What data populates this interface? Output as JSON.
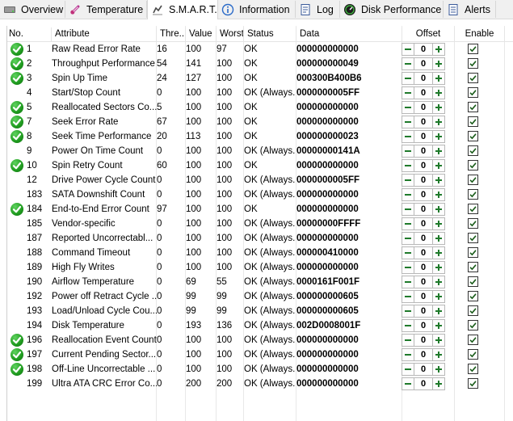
{
  "tabs": [
    {
      "label": "Overview",
      "icon": "drive-overview-icon"
    },
    {
      "label": "Temperature",
      "icon": "thermometer-icon"
    },
    {
      "label": "S.M.A.R.T.",
      "icon": "smart-icon"
    },
    {
      "label": "Information",
      "icon": "information-icon"
    },
    {
      "label": "Log",
      "icon": "log-icon"
    },
    {
      "label": "Disk Performance",
      "icon": "gauge-icon"
    },
    {
      "label": "Alerts",
      "icon": "alerts-icon"
    }
  ],
  "active_tab": "S.M.A.R.T.",
  "columns": {
    "no": "No.",
    "attribute": "Attribute",
    "threshold": "Thre...",
    "value": "Value",
    "worst": "Worst",
    "status": "Status",
    "data": "Data",
    "offset": "Offset",
    "enable": "Enable"
  },
  "colors": {
    "ok_green": "#1e9a1e",
    "stepper_green": "#1f7a2b"
  },
  "rows": [
    {
      "no": "1",
      "icon": true,
      "attribute": "Raw Read Error Rate",
      "threshold": "16",
      "value": "100",
      "worst": "97",
      "status": "OK",
      "data": "000000000000",
      "offset": "0",
      "enabled": true
    },
    {
      "no": "2",
      "icon": true,
      "attribute": "Throughput Performance",
      "threshold": "54",
      "value": "141",
      "worst": "100",
      "status": "OK",
      "data": "000000000049",
      "offset": "0",
      "enabled": true
    },
    {
      "no": "3",
      "icon": true,
      "attribute": "Spin Up Time",
      "threshold": "24",
      "value": "127",
      "worst": "100",
      "status": "OK",
      "data": "000300B400B6",
      "offset": "0",
      "enabled": true
    },
    {
      "no": "4",
      "icon": false,
      "attribute": "Start/Stop Count",
      "threshold": "0",
      "value": "100",
      "worst": "100",
      "status": "OK (Always...",
      "data": "0000000005FF",
      "offset": "0",
      "enabled": true
    },
    {
      "no": "5",
      "icon": true,
      "attribute": "Reallocated Sectors Co...",
      "threshold": "5",
      "value": "100",
      "worst": "100",
      "status": "OK",
      "data": "000000000000",
      "offset": "0",
      "enabled": true
    },
    {
      "no": "7",
      "icon": true,
      "attribute": "Seek Error Rate",
      "threshold": "67",
      "value": "100",
      "worst": "100",
      "status": "OK",
      "data": "000000000000",
      "offset": "0",
      "enabled": true
    },
    {
      "no": "8",
      "icon": true,
      "attribute": "Seek Time Performance",
      "threshold": "20",
      "value": "113",
      "worst": "100",
      "status": "OK",
      "data": "000000000023",
      "offset": "0",
      "enabled": true
    },
    {
      "no": "9",
      "icon": false,
      "attribute": "Power On Time Count",
      "threshold": "0",
      "value": "100",
      "worst": "100",
      "status": "OK (Always...",
      "data": "00000000141A",
      "offset": "0",
      "enabled": true
    },
    {
      "no": "10",
      "icon": true,
      "attribute": "Spin Retry Count",
      "threshold": "60",
      "value": "100",
      "worst": "100",
      "status": "OK",
      "data": "000000000000",
      "offset": "0",
      "enabled": true
    },
    {
      "no": "12",
      "icon": false,
      "attribute": "Drive Power Cycle Count",
      "threshold": "0",
      "value": "100",
      "worst": "100",
      "status": "OK (Always...",
      "data": "0000000005FF",
      "offset": "0",
      "enabled": true
    },
    {
      "no": "183",
      "icon": false,
      "attribute": "SATA Downshift Count",
      "threshold": "0",
      "value": "100",
      "worst": "100",
      "status": "OK (Always...",
      "data": "000000000000",
      "offset": "0",
      "enabled": true
    },
    {
      "no": "184",
      "icon": true,
      "attribute": "End-to-End Error Count",
      "threshold": "97",
      "value": "100",
      "worst": "100",
      "status": "OK",
      "data": "000000000000",
      "offset": "0",
      "enabled": true
    },
    {
      "no": "185",
      "icon": false,
      "attribute": "Vendor-specific",
      "threshold": "0",
      "value": "100",
      "worst": "100",
      "status": "OK (Always...",
      "data": "00000000FFFF",
      "offset": "0",
      "enabled": true
    },
    {
      "no": "187",
      "icon": false,
      "attribute": "Reported Uncorrectabl...",
      "threshold": "0",
      "value": "100",
      "worst": "100",
      "status": "OK (Always...",
      "data": "000000000000",
      "offset": "0",
      "enabled": true
    },
    {
      "no": "188",
      "icon": false,
      "attribute": "Command Timeout",
      "threshold": "0",
      "value": "100",
      "worst": "100",
      "status": "OK (Always...",
      "data": "000000410000",
      "offset": "0",
      "enabled": true
    },
    {
      "no": "189",
      "icon": false,
      "attribute": "High Fly Writes",
      "threshold": "0",
      "value": "100",
      "worst": "100",
      "status": "OK (Always...",
      "data": "000000000000",
      "offset": "0",
      "enabled": true
    },
    {
      "no": "190",
      "icon": false,
      "attribute": "Airflow Temperature",
      "threshold": "0",
      "value": "69",
      "worst": "55",
      "status": "OK (Always...",
      "data": "0000161F001F",
      "offset": "0",
      "enabled": true
    },
    {
      "no": "192",
      "icon": false,
      "attribute": "Power off Retract Cycle ...",
      "threshold": "0",
      "value": "99",
      "worst": "99",
      "status": "OK (Always...",
      "data": "000000000605",
      "offset": "0",
      "enabled": true
    },
    {
      "no": "193",
      "icon": false,
      "attribute": "Load/Unload Cycle Cou...",
      "threshold": "0",
      "value": "99",
      "worst": "99",
      "status": "OK (Always...",
      "data": "000000000605",
      "offset": "0",
      "enabled": true
    },
    {
      "no": "194",
      "icon": false,
      "attribute": "Disk Temperature",
      "threshold": "0",
      "value": "193",
      "worst": "136",
      "status": "OK (Always...",
      "data": "002D0008001F",
      "offset": "0",
      "enabled": true
    },
    {
      "no": "196",
      "icon": true,
      "attribute": "Reallocation Event Count",
      "threshold": "0",
      "value": "100",
      "worst": "100",
      "status": "OK (Always...",
      "data": "000000000000",
      "offset": "0",
      "enabled": true
    },
    {
      "no": "197",
      "icon": true,
      "attribute": "Current Pending Sector...",
      "threshold": "0",
      "value": "100",
      "worst": "100",
      "status": "OK (Always...",
      "data": "000000000000",
      "offset": "0",
      "enabled": true
    },
    {
      "no": "198",
      "icon": true,
      "attribute": "Off-Line Uncorrectable ...",
      "threshold": "0",
      "value": "100",
      "worst": "100",
      "status": "OK (Always...",
      "data": "000000000000",
      "offset": "0",
      "enabled": true
    },
    {
      "no": "199",
      "icon": false,
      "attribute": "Ultra ATA CRC Error Co...",
      "threshold": "0",
      "value": "200",
      "worst": "200",
      "status": "OK (Always...",
      "data": "000000000000",
      "offset": "0",
      "enabled": true
    }
  ]
}
